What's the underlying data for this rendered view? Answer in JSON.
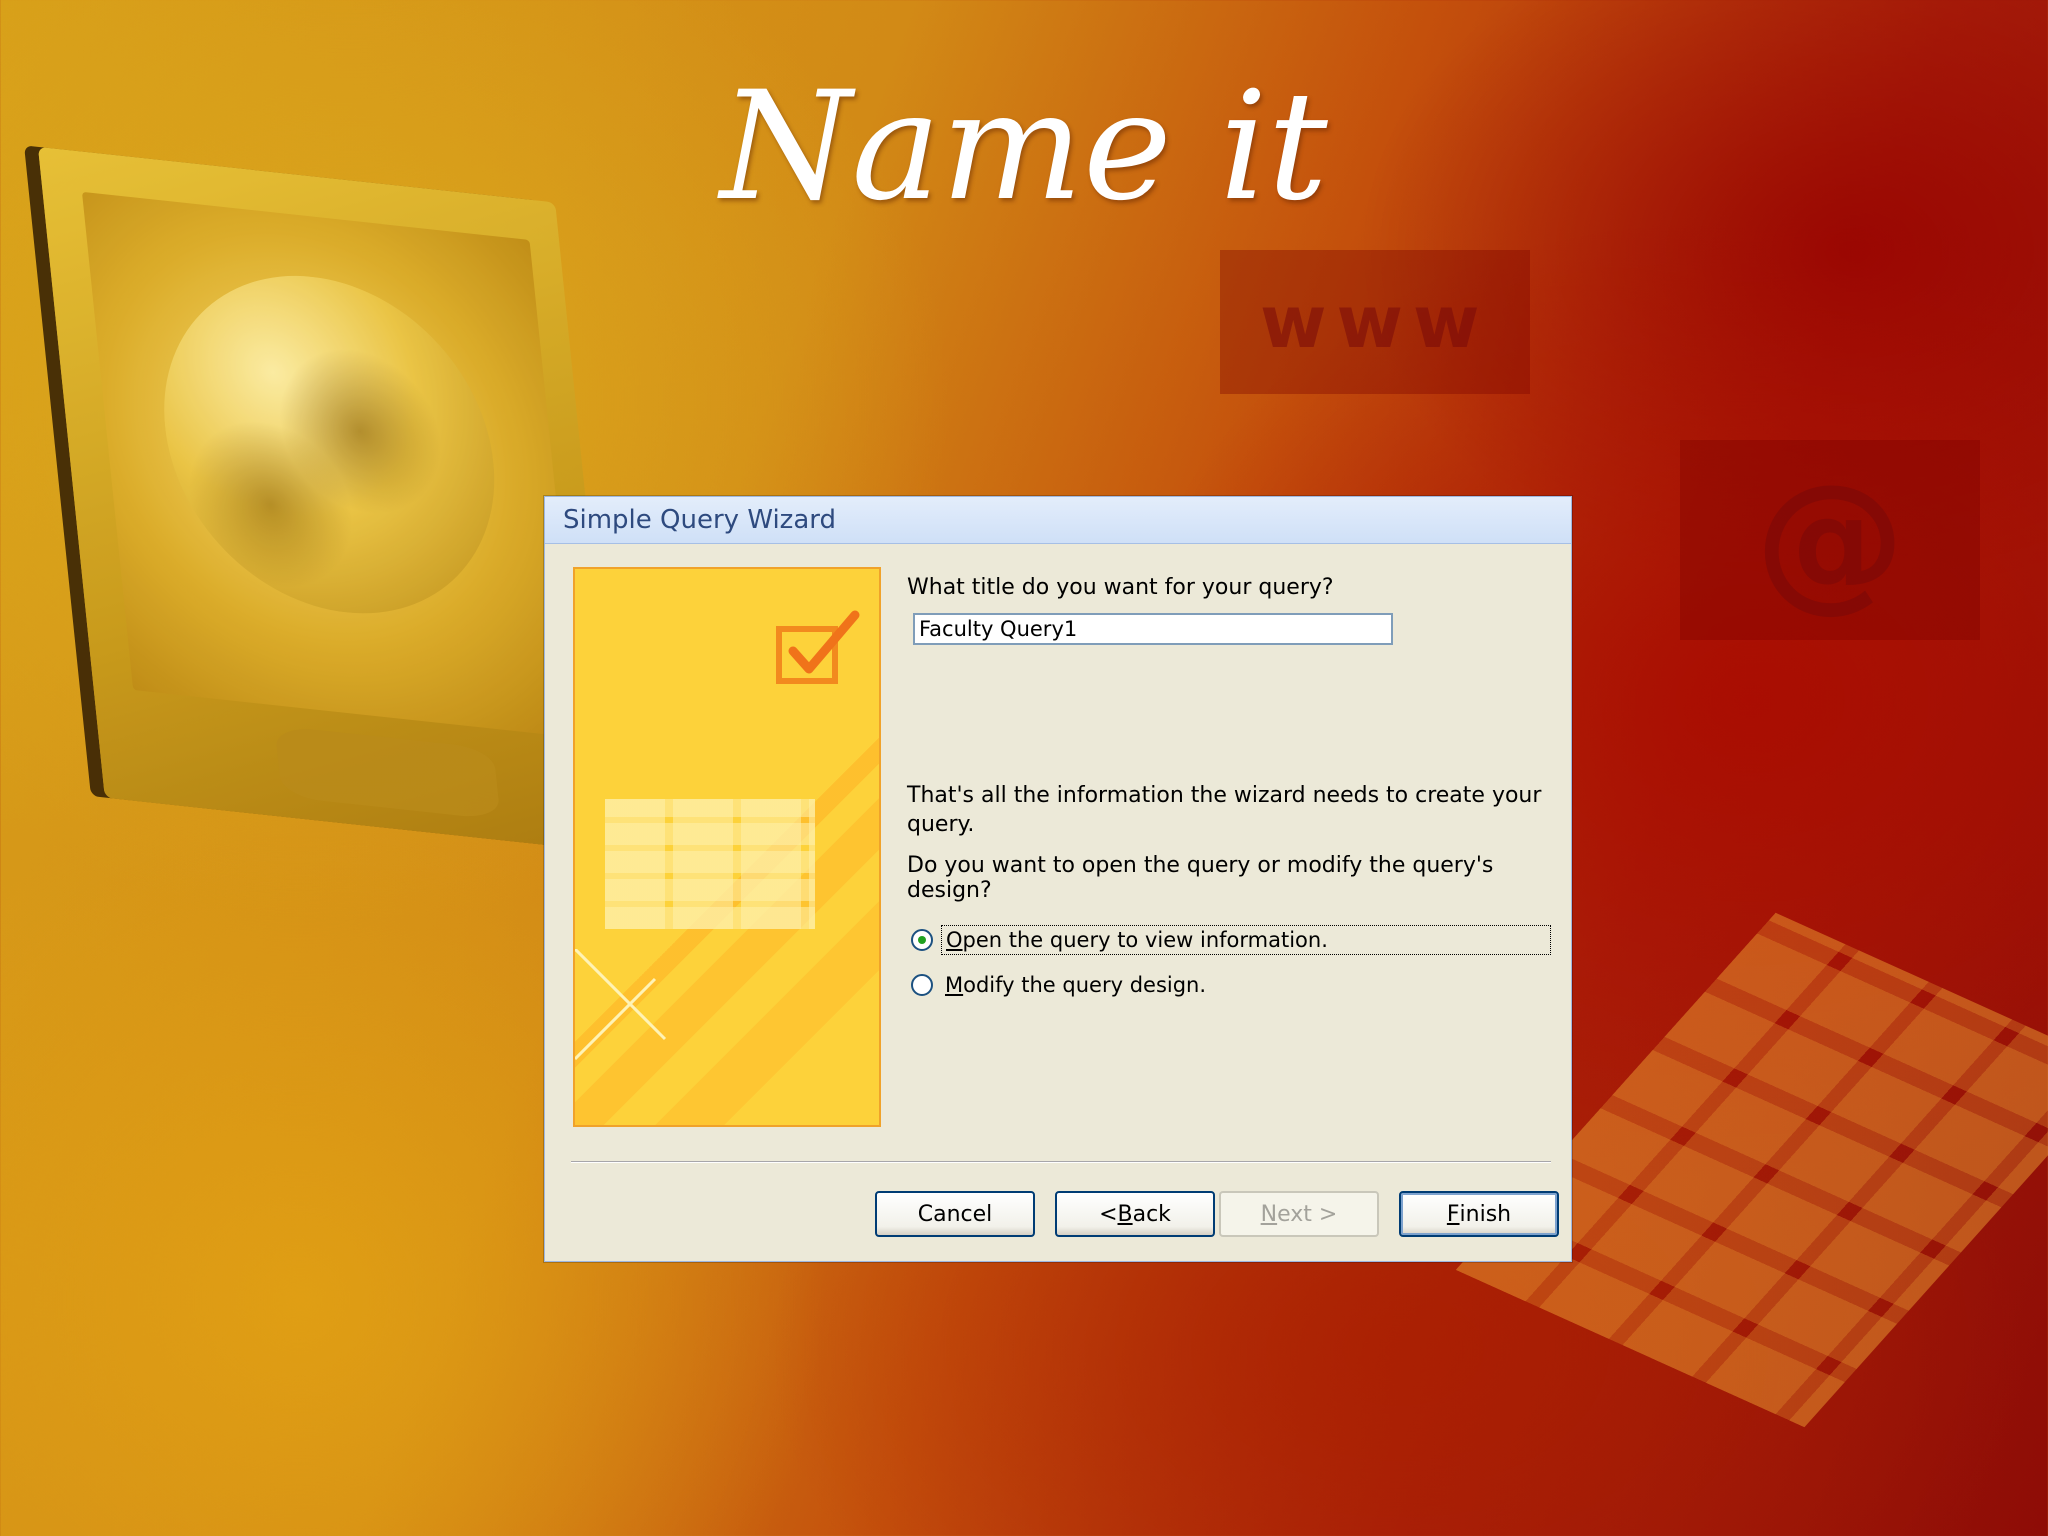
{
  "slide": {
    "title": "Name it",
    "bg_text_www": "www",
    "bg_text_at": "@"
  },
  "dialog": {
    "title": "Simple Query Wizard",
    "question": "What title do you want for your query?",
    "query_title_value": "Faculty Query1",
    "info_text": "That's all the information the wizard needs to create your query.",
    "design_question": "Do you want to open the query or modify the query's design?",
    "options": [
      {
        "accel": "O",
        "rest": "pen the query to view information.",
        "selected": true
      },
      {
        "accel": "M",
        "rest": "odify the query design.",
        "selected": false
      }
    ],
    "buttons": {
      "cancel": "Cancel",
      "back_prefix": "< ",
      "back_accel": "B",
      "back_rest": "ack",
      "next_accel": "N",
      "next_rest": "ext >",
      "finish_accel": "F",
      "finish_rest": "inish"
    }
  },
  "colors": {
    "accent_orange": "#f0a22a",
    "wizard_yellow": "#fdd23a",
    "button_border": "#003c74",
    "radio_selected": "#21a121"
  }
}
